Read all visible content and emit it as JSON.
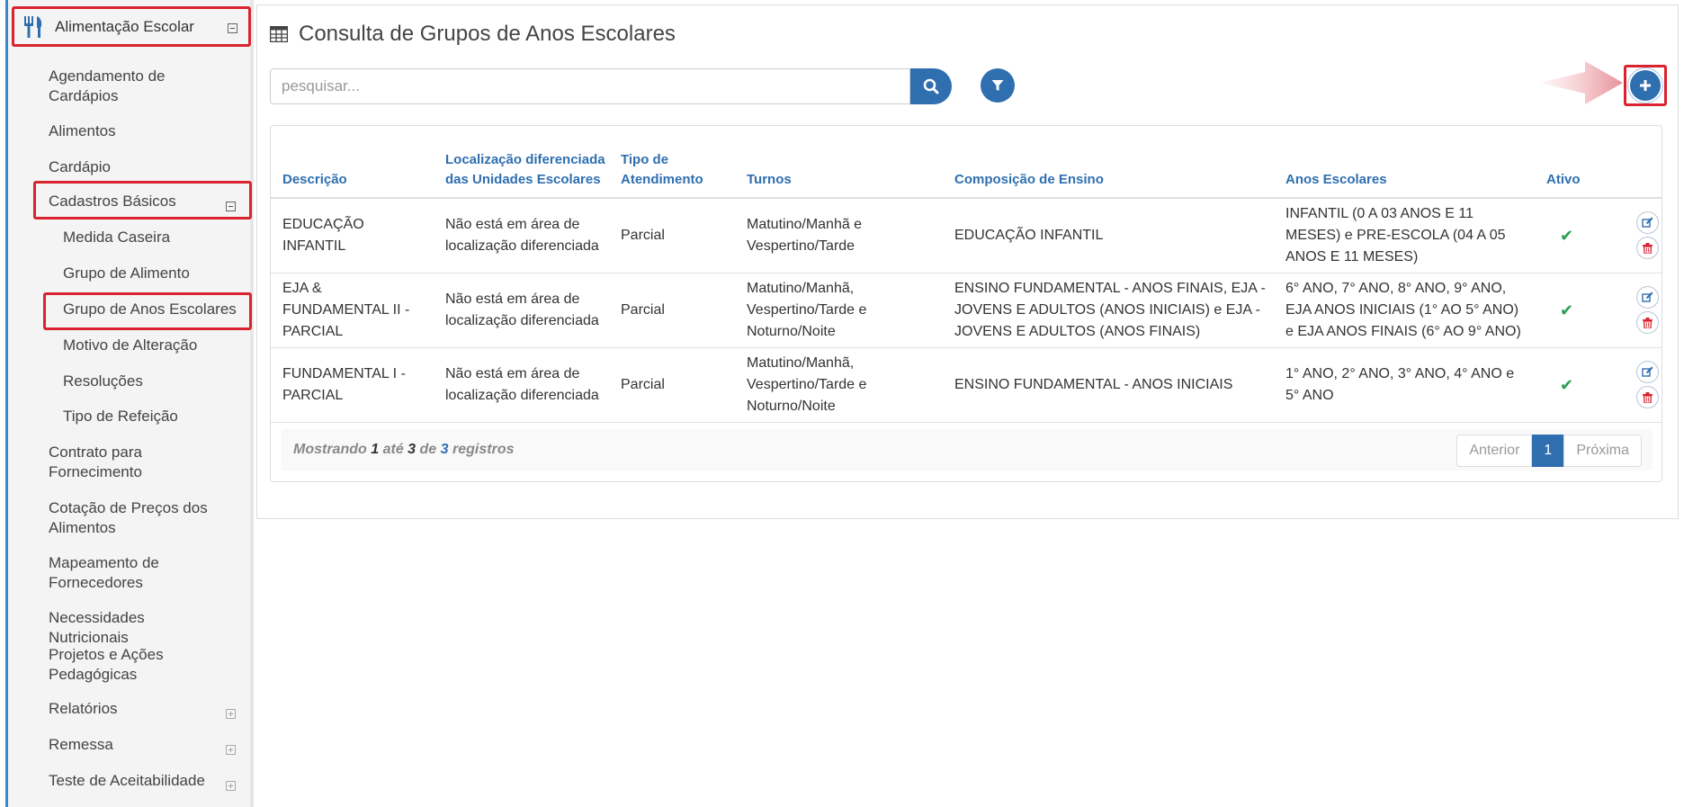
{
  "sidebar": {
    "header_label": "Alimentação Escolar",
    "items": [
      {
        "label": "Agendamento de Cardápios"
      },
      {
        "label": "Alimentos"
      },
      {
        "label": "Cardápio"
      },
      {
        "label": "Cadastros Básicos"
      },
      {
        "label": "Medida Caseira"
      },
      {
        "label": "Grupo de Alimento"
      },
      {
        "label": "Grupo de Anos Escolares"
      },
      {
        "label": "Motivo de Alteração"
      },
      {
        "label": "Resoluções"
      },
      {
        "label": "Tipo de Refeição"
      },
      {
        "label": "Contrato para Fornecimento"
      },
      {
        "label": "Cotação de Preços dos Alimentos"
      },
      {
        "label": "Mapeamento de Fornecedores"
      },
      {
        "label": "Necessidades Nutricionais"
      },
      {
        "label": "Projetos e Ações Pedagógicas"
      },
      {
        "label": "Relatórios"
      },
      {
        "label": "Remessa"
      },
      {
        "label": "Teste de Aceitabilidade"
      }
    ]
  },
  "page": {
    "title": "Consulta de Grupos de Anos Escolares",
    "search_placeholder": "pesquisar..."
  },
  "table": {
    "headers": [
      "Descrição",
      "Localização diferenciada das Unidades Escolares",
      "Tipo de Atendimento",
      "Turnos",
      "Composição de Ensino",
      "Anos Escolares",
      "Ativo"
    ],
    "rows": [
      {
        "descricao": "EDUCAÇÃO INFANTIL",
        "localizacao": "Não está em área de localização diferenciada",
        "tipo": "Parcial",
        "turnos": "Matutino/Manhã e Vespertino/Tarde",
        "composicao": "EDUCAÇÃO INFANTIL",
        "anos": "INFANTIL (0 A 03 ANOS E 11 MESES) e PRE-ESCOLA (04 A 05 ANOS E 11 MESES)",
        "ativo": "✔"
      },
      {
        "descricao": "EJA & FUNDAMENTAL II - PARCIAL",
        "localizacao": "Não está em área de localização diferenciada",
        "tipo": "Parcial",
        "turnos": "Matutino/Manhã, Vespertino/Tarde e Noturno/Noite",
        "composicao": "ENSINO FUNDAMENTAL - ANOS FINAIS, EJA - JOVENS E ADULTOS (ANOS INICIAIS) e EJA - JOVENS E ADULTOS (ANOS FINAIS)",
        "anos": "6° ANO, 7° ANO, 8° ANO, 9° ANO, EJA ANOS INICIAIS (1° AO 5° ANO) e EJA ANOS FINAIS (6° AO 9° ANO)",
        "ativo": "✔"
      },
      {
        "descricao": "FUNDAMENTAL I - PARCIAL",
        "localizacao": "Não está em área de localização diferenciada",
        "tipo": "Parcial",
        "turnos": "Matutino/Manhã, Vespertino/Tarde e Noturno/Noite",
        "composicao": "ENSINO FUNDAMENTAL - ANOS INICIAIS",
        "anos": "1° ANO, 2° ANO, 3° ANO, 4° ANO e 5° ANO",
        "ativo": "✔"
      }
    ]
  },
  "footer": {
    "showing_prefix": "Mostrando",
    "from": "1",
    "to_word": "até",
    "to": "3",
    "of_word": "de",
    "total": "3",
    "suffix": "registros",
    "prev_label": "Anterior",
    "current_page": "1",
    "next_label": "Próxima"
  },
  "icons": {
    "menu": "fork-knife-icon",
    "title": "table-icon",
    "search": "search-icon",
    "filter": "filter-icon",
    "add": "plus-icon",
    "edit": "edit-icon",
    "delete": "trash-icon",
    "active": "check-icon"
  },
  "colors": {
    "primary": "#2f6fb0",
    "highlight": "#d9232e",
    "active_check": "#2aa055",
    "delete": "#d9232e"
  }
}
